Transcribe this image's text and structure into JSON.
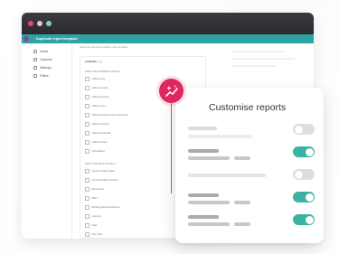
{
  "window": {
    "title": "Duplicate report template"
  },
  "sidebar": {
    "items": [
      {
        "label": "Home",
        "icon": "home-icon"
      },
      {
        "label": "Columns",
        "icon": "columns-icon"
      },
      {
        "label": "Settings",
        "icon": "gear-icon"
      },
      {
        "label": "Filters",
        "icon": "filter-icon"
      }
    ]
  },
  "main": {
    "note": "Select the columns to include in your template",
    "available_label": "Available",
    "available_count": "(13)",
    "group1": {
      "title": "EMPLOYEE ADDRESS DETAILS",
      "fields": [
        "Address City",
        "Address County",
        "Address Country",
        "Address Line",
        "Address Postal Number and Street",
        "Address Number",
        "Address Postcode",
        "Address Street",
        "Full Address"
      ]
    },
    "group2": {
      "title": "EMPLOYEE BANK DETAILS",
      "fields": [
        "Account Holder Name",
        "Account Position Number",
        "Bank Name",
        "IBAN",
        "Building Society Reference",
        "Currency",
        "Swift",
        "Sort Code"
      ]
    }
  },
  "card": {
    "title": "Customise reports",
    "rows": [
      {
        "toggle": "off"
      },
      {
        "toggle": "on"
      },
      {
        "toggle": "off"
      },
      {
        "toggle": "on"
      },
      {
        "toggle": "on"
      }
    ]
  },
  "colors": {
    "accent_pink": "#e0275f",
    "accent_teal": "#3bb3a4",
    "toggle_off": "#dcdfe0",
    "appbar": "#2fa3a3"
  },
  "badge": {
    "icon": "sparkle-trend-icon"
  }
}
